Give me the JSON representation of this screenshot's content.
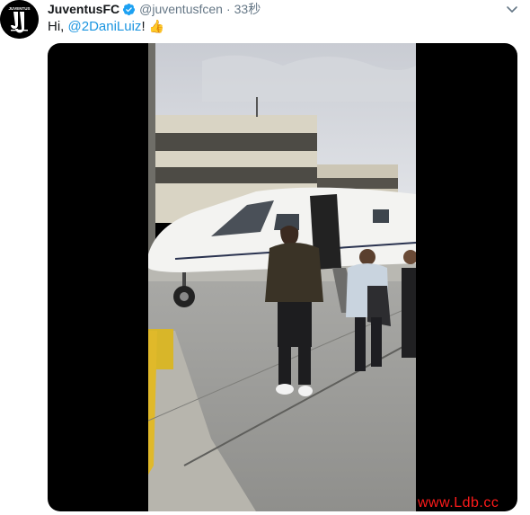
{
  "tweet": {
    "display_name": "JuventusFC",
    "handle": "@juventusfcen",
    "separator": "·",
    "time": "33秒",
    "text_prefix": "Hi, ",
    "mention": "@2DaniLuiz",
    "text_suffix": "!",
    "emoji": "👍"
  },
  "watermark": "www.Ldb.cc",
  "colors": {
    "link": "#1b95e0",
    "muted": "#657786",
    "verified": "#1da1f2",
    "watermark": "#ff1a1a"
  },
  "icons": {
    "avatar": "juventus-logo-icon",
    "verified": "verified-badge-icon",
    "menu": "chevron-down-icon",
    "thumb": "thumbs-up-icon"
  }
}
